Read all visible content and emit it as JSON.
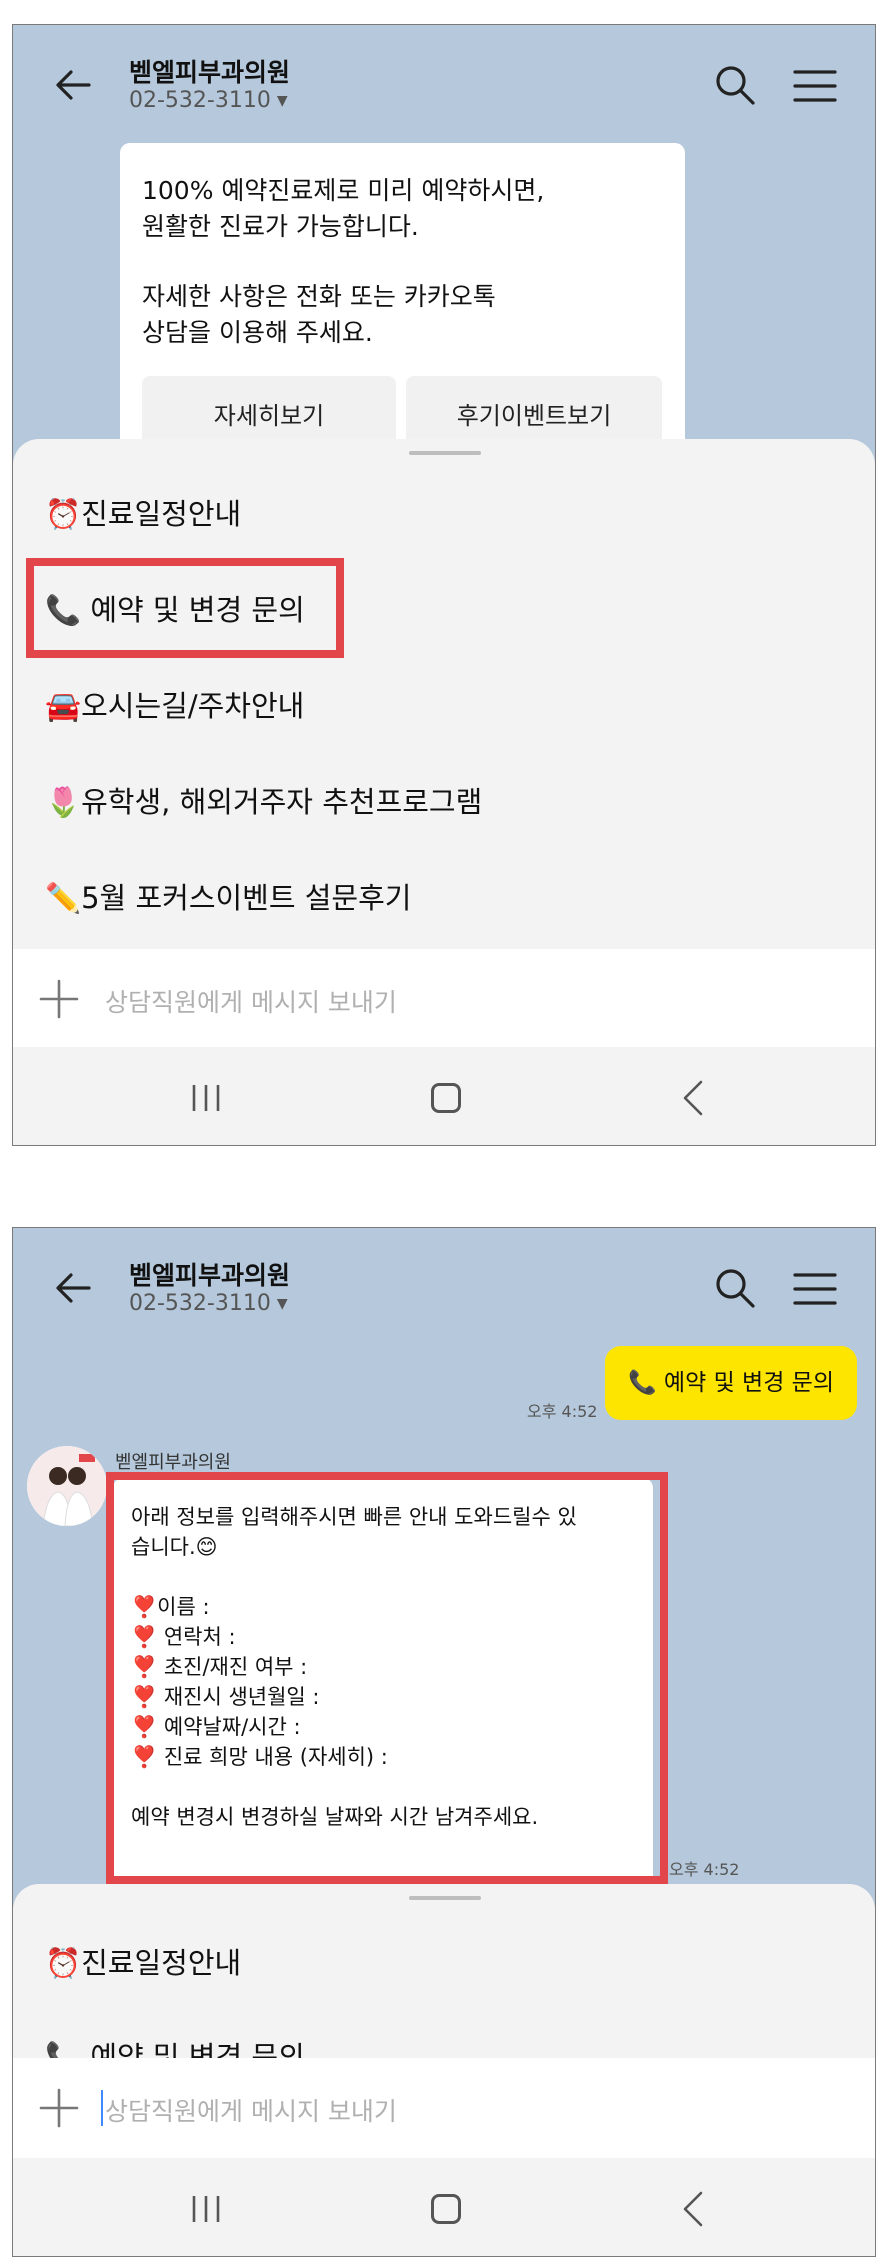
{
  "chat": {
    "title": "벧엘피부과의원",
    "phone": "02-532-3110",
    "phone_caret": "▼"
  },
  "screen1": {
    "bubble_lines": [
      "100% 예약진료제로 미리 예약하시면,",
      "원활한 진료가 가능합니다.",
      "",
      "자세한 사항은 전화 또는 카카오톡",
      "상담을 이용해 주세요."
    ],
    "buttons": [
      "자세히보기",
      "후기이벤트보기"
    ],
    "menu": [
      {
        "emoji": "⏰",
        "label": "진료일정안내"
      },
      {
        "emoji": "📞",
        "label": " 예약 및 변경 문의"
      },
      {
        "emoji": "🚘",
        "label": "오시는길/주차안내"
      },
      {
        "emoji": "🌷",
        "label": "유학생, 해외거주자 추천프로그램"
      },
      {
        "emoji": "✏️",
        "label": "5월 포커스이벤트 설문후기"
      }
    ],
    "placeholder": "상담직원에게 메시지 보내기"
  },
  "screen2": {
    "sent_message": "📞 예약 및 변경 문의",
    "sent_time": "오후 4:52",
    "sender_name": "벧엘피부과의원",
    "received_lines": [
      "아래 정보를 입력해주시면 빠른 안내 도와드릴수 있",
      "습니다.😊",
      "",
      "❣️이름 :",
      "❣️ 연락처 :",
      "❣️ 초진/재진 여부 :",
      "❣️ 재진시 생년월일 :",
      "❣️ 예약날짜/시간 :",
      "❣️ 진료 희망 내용 (자세히) :",
      "",
      "예약 변경시 변경하실 날짜와 시간 남겨주세요."
    ],
    "received_time": "오후 4:52",
    "menu": [
      {
        "emoji": "⏰",
        "label": "진료일정안내"
      },
      {
        "emoji": "📞",
        "label": " 예약 및 변경 문의"
      }
    ],
    "placeholder": "상담직원에게 메시지 보내기"
  },
  "colors": {
    "background": "#b6c9dc",
    "highlight": "#e2464b",
    "sent_bubble": "#fee500",
    "panel": "#f3f3f3"
  },
  "icons": [
    "back-arrow-icon",
    "search-icon",
    "hamburger-menu-icon",
    "plus-icon",
    "recent-apps-icon",
    "home-icon",
    "nav-back-icon"
  ]
}
